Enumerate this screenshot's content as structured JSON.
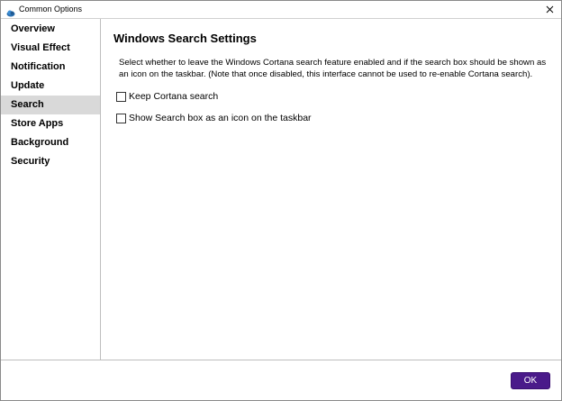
{
  "window": {
    "title": "Common Options",
    "app_icon": "cloud-icon",
    "close_icon": "close-icon"
  },
  "sidebar": {
    "items": [
      {
        "label": "Overview",
        "selected": false
      },
      {
        "label": "Visual Effect",
        "selected": false
      },
      {
        "label": "Notification",
        "selected": false
      },
      {
        "label": "Update",
        "selected": false
      },
      {
        "label": "Search",
        "selected": true
      },
      {
        "label": "Store Apps",
        "selected": false
      },
      {
        "label": "Background",
        "selected": false
      },
      {
        "label": "Security",
        "selected": false
      }
    ],
    "selected_bg": "#d9d9d9"
  },
  "main": {
    "heading": "Windows Search Settings",
    "description_line1": "Select whether to leave the Windows Cortana search feature enabled and if the search box should be shown as",
    "description_line2": "an icon on the taskbar.  (Note that once disabled, this interface cannot be used to re-enable Cortana search).",
    "options": [
      {
        "label": "Keep Cortana search",
        "checked": false
      },
      {
        "label": "Show Search box as an icon on the taskbar",
        "checked": false
      }
    ]
  },
  "footer": {
    "ok_label": "OK",
    "ok_color": "#4a1a8a"
  }
}
